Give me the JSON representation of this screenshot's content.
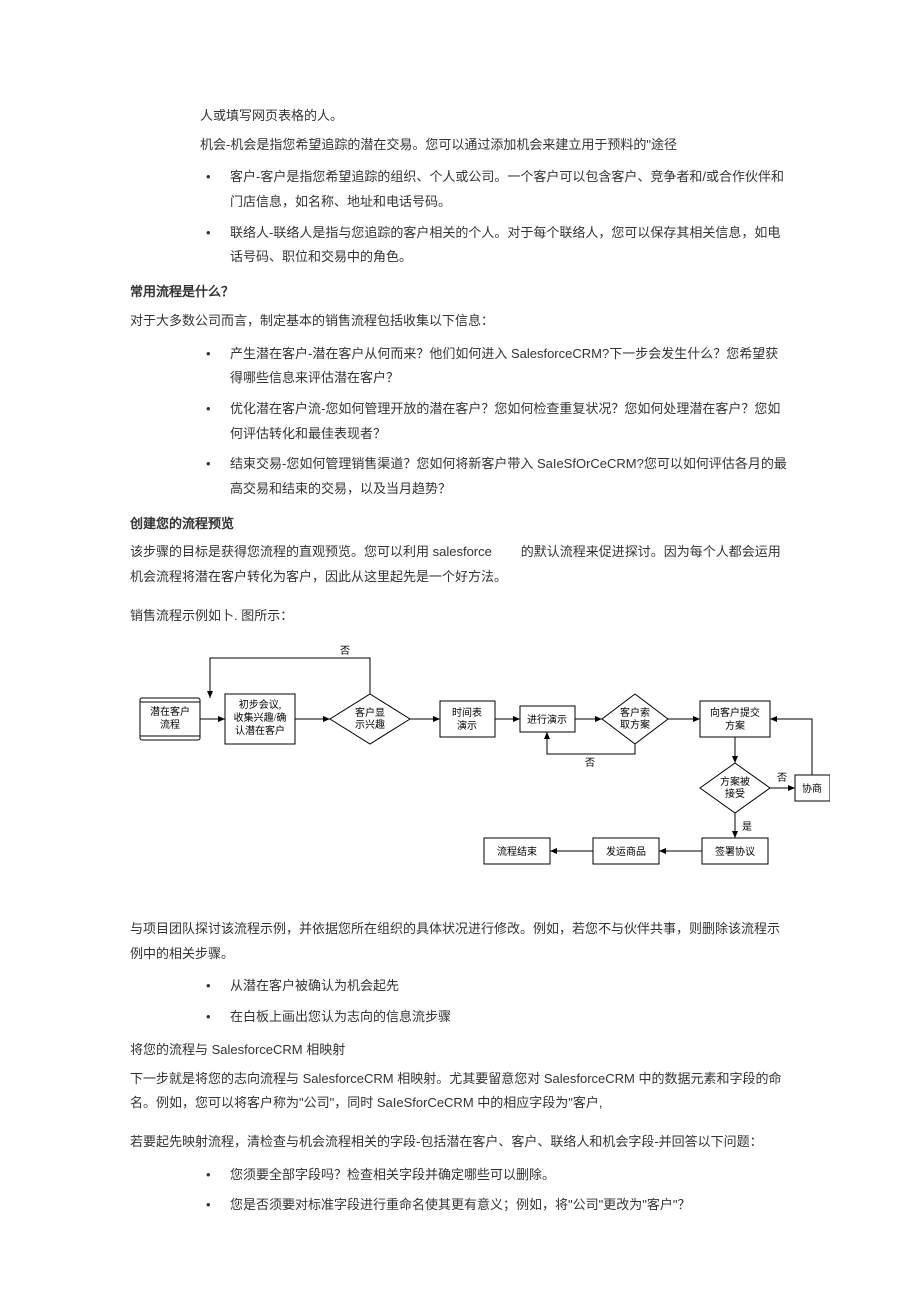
{
  "intro": {
    "line1": "人或填写网页表格的人。",
    "line2": "机会-机会是指您希望追踪的潜在交易。您可以通过添加机会来建立用于预料的\"途径"
  },
  "defs": [
    "客户-客户是指您希望追踪的组织、个人或公司。一个客户可以包含客户、竞争者和/或合作伙伴和门店信息，如名称、地址和电话号码。",
    "联络人-联络人是指与您追踪的客户相关的个人。对于每个联络人，您可以保存其相关信息，如电话号码、职位和交易中的角色。"
  ],
  "section1": {
    "heading": "常用流程是什么？",
    "intro": "对于大多数公司而言，制定基本的销售流程包括收集以下信息：",
    "items": [
      "产生潜在客户-潜在客户从何而来？他们如何进入 SalesforceCRM?下一步会发生什么？您希望获得哪些信息来评估潜在客户？",
      "优化潜在客户流-您如何管理开放的潜在客户？您如何检查重复状况？您如何处理潜在客户？您如何评估转化和最佳表现者？",
      "结束交易-您如何管理销售渠道？您如何将新客户带入 SaIeSfOrCeCRM?您可以如何评估各月的最高交易和结束的交易，以及当月趋势？"
    ]
  },
  "section2": {
    "heading": "创建您的流程预览",
    "p1a": "该步骤的目标是获得您流程的直观预览。您可以利用 salesforce",
    "p1b": "的默认流程来促进探讨。因为每个人都会运用机会流程将潜在客户转化为客户，因此从这里起先是一个好方法。",
    "p2": "销售流程示例如卜. 图所示："
  },
  "flowchart": {
    "n1": "潜在客户流程",
    "n2a": "初步会议,",
    "n2b": "收集兴趣/确",
    "n2c": "认潜在客户",
    "n3a": "客户显",
    "n3b": "示兴趣",
    "n4a": "时间表",
    "n4b": "演示",
    "n5": "进行演示",
    "n6a": "客户索",
    "n6b": "取方案",
    "n7a": "向客户提交",
    "n7b": "方案",
    "n8a": "方案被",
    "n8b": "接受",
    "n9": "协商",
    "n10": "签署协议",
    "n11": "发运商品",
    "n12": "流程结束",
    "yes": "是",
    "no": "否"
  },
  "section3": {
    "p1": "与项目团队探讨该流程示例，并依据您所在组织的具体状况进行修改。例如，若您不与伙伴共事，则删除该流程示例中的相关步骤。",
    "items": [
      "从潜在客户被确认为机会起先",
      "在白板上画出您认为志向的信息流步骤"
    ],
    "p2": "将您的流程与 SalesforceCRM 相映射",
    "p3": "下一步就是将您的志向流程与 SalesforceCRM 相映射。尤其要留意您对 SalesforceCRM 中的数据元素和字段的命名。例如，您可以将客户称为\"公司\"，同时 SaIeSforCeCRM 中的相应字段为\"客户,",
    "p4": "若要起先映射流程，清检查与机会流程相关的字段-包括潜在客户、客户、联络人和机会字段-并回答以下问题：",
    "items2": [
      "您须要全部字段吗？检查相关字段并确定哪些可以删除。",
      "您是否须要对标准字段进行重命名使其更有意义；例如，将\"公司\"更改为\"客户\"？"
    ]
  }
}
